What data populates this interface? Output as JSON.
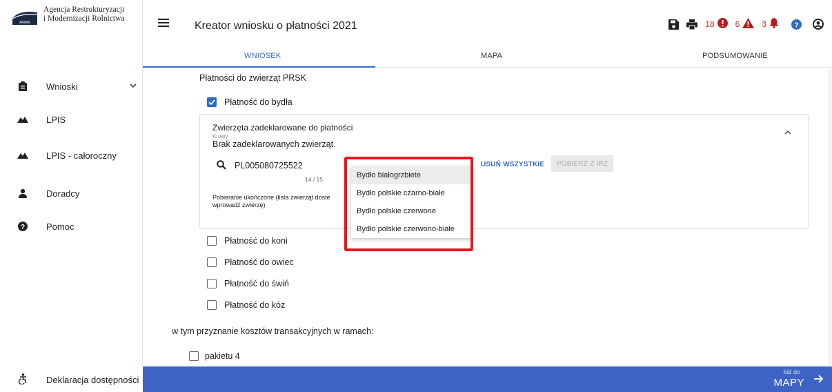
{
  "sidebar": {
    "logo_line1": "Agencja Restrukturyzacji",
    "logo_line2": "i Modernizacji Rolnictwa",
    "logo_badge": "ARiMR",
    "items": [
      {
        "label": "Wnioski",
        "icon": "clipboard-icon"
      },
      {
        "label": "LPIS",
        "icon": "mountain-icon"
      },
      {
        "label": "LPIS - całoroczny",
        "icon": "mountain-icon"
      },
      {
        "label": "Doradcy",
        "icon": "person-icon"
      },
      {
        "label": "Pomoc",
        "icon": "help-icon"
      }
    ],
    "accessibility_label": "Deklaracja dostępności"
  },
  "header": {
    "title": "Kreator wniosku o płatności 2021",
    "errors_count": "18",
    "warnings_count": "6",
    "notifications_count": "3"
  },
  "tabs": [
    "WNIOSEK",
    "MAPA",
    "PODSUMOWANIE"
  ],
  "main": {
    "section_title": "Płatności do zwierząt PRSK",
    "cattle_payment": "Płatność do bydła",
    "panel": {
      "title": "Zwierzęta zadeklarowane do płatności",
      "subtitle": "Krowy",
      "empty_text": "Brak zadeklarowanych zwierząt.",
      "search_value": "PL005080725522",
      "counter": "14 / 15",
      "status_line1": "Pobieranie ukończone (lista zwierząt doste",
      "status_line2": "wprowadź zwierzę)",
      "remove_all": "USUŃ WSZYSTKIE",
      "fetch_irz": "POBIERZ Z IRZ"
    },
    "dropdown_options": [
      "Bydło białogrzbiete",
      "Bydło polskie czarno-białe",
      "Bydło polskie czerwone",
      "Bydło polskie czerwono-białe"
    ],
    "other_payments": [
      "Płatność do koni",
      "Płatność do owiec",
      "Płatność do świń",
      "Płatność do kóz"
    ],
    "cost_title": "w tym przyznanie kosztów transakcyjnych w ramach:",
    "package": "pakietu 4"
  },
  "footer": {
    "go_small": "Idź do",
    "go_big": "MAPY"
  },
  "colors": {
    "accent": "#2e6bc4",
    "footer": "#3d64c4",
    "error": "#c0392b",
    "highlight": "#e8141c"
  }
}
